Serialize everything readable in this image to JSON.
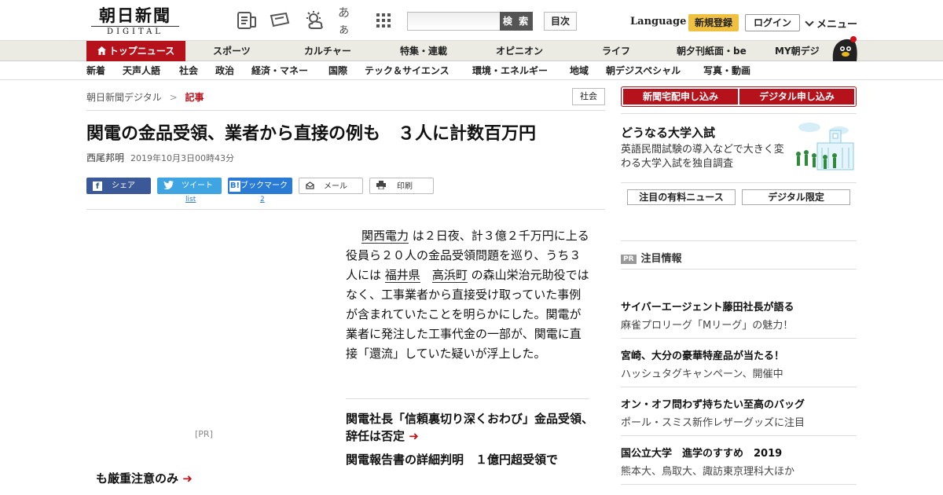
{
  "header": {
    "logo_jp": "朝日新聞",
    "logo_en": "DIGITAL",
    "search_button": "検 索",
    "toc_button": "目次",
    "language": "Language",
    "register": "新規登録",
    "login": "ログイン",
    "menu": "メニュー",
    "font_size_glyph": "あぁ"
  },
  "nav_primary": [
    {
      "label": "トップニュース",
      "active": true
    },
    {
      "label": "スポーツ"
    },
    {
      "label": "カルチャー"
    },
    {
      "label": "特集・連載"
    },
    {
      "label": "オピニオン"
    },
    {
      "label": "ライフ"
    },
    {
      "label": "朝夕刊紙面・be"
    },
    {
      "label": "MY朝デジ"
    }
  ],
  "nav_secondary": [
    "新着",
    "天声人語",
    "社会",
    "政治",
    "経済・マネー",
    "国際",
    "テック＆サイエンス",
    "環境・エネルギー",
    "地域",
    "朝デジスペシャル",
    "写真・動画"
  ],
  "breadcrumb": {
    "home": "朝日新聞デジタル",
    "sep": ">",
    "current": "記事"
  },
  "category_tag": "社会",
  "article": {
    "headline": "関電の金品受領、業者から直接の例も　３人に計数百万円",
    "author": "西尾邦明",
    "date": "2019年10月3日00時43分",
    "body_parts": {
      "p1_link": "関西電力",
      "p1_a": " は２日夜、計３億２千万円に上る役員ら２０人の金品受領問題を巡り、うち３人には ",
      "p1_link2": "福井県",
      "p1_link3": "高浜町",
      "p1_b": " の森山栄治元助役ではなく、工事業者から直接受け取っていた事例が含まれていたことを明らかにした。関電が業者に発注した工事代金の一部が、関電に直接「還流」していた疑いが浮上した。"
    }
  },
  "share": {
    "facebook": "シェア",
    "twitter": "ツイート",
    "twitter_count": "list",
    "hatena": "ブックマーク",
    "hatena_count": "2",
    "mail": "メール",
    "print": "印刷"
  },
  "left_column": {
    "pr": "[PR]",
    "link": "も厳重注意のみ"
  },
  "related": [
    "関電社長「信頼裏切り深くおわび」金品受領、辞任は否定",
    "関電報告書の詳細判明　１億円超受領で"
  ],
  "sidebar": {
    "subscribe_paper": "新聞宅配申し込み",
    "subscribe_digital": "デジタル申し込み",
    "feature_title": "どうなる大学入試",
    "feature_desc": "英語民間試験の導入などで大きく変わる大学入試を独自調査",
    "tab_paid": "注目の有料ニュース",
    "tab_digital": "デジタル限定",
    "pr_badge": "PR",
    "pr_heading": "注目情報",
    "ads": [
      {
        "title": "サイバーエージェント藤田社長が語る",
        "desc": "麻雀プロリーグ「Mリーグ」の魅力！"
      },
      {
        "title": "宮崎、大分の豪華特産品が当たる！",
        "desc": "ハッシュタグキャンペーン、開催中"
      },
      {
        "title": "オン・オフ問わず持ちたい至高のバッグ",
        "desc": "ポール・スミス新作レザーグッズに注目"
      },
      {
        "title": "国公立大学　進学のすすめ　2019",
        "desc": "熊本大、鳥取大、諏訪東京理科大ほか"
      }
    ]
  },
  "colors": {
    "brand_red": "#b5121b",
    "register_yellow": "#f0c040",
    "facebook": "#3b5998",
    "twitter": "#3fa4e2",
    "hatena": "#2a7bd3"
  }
}
